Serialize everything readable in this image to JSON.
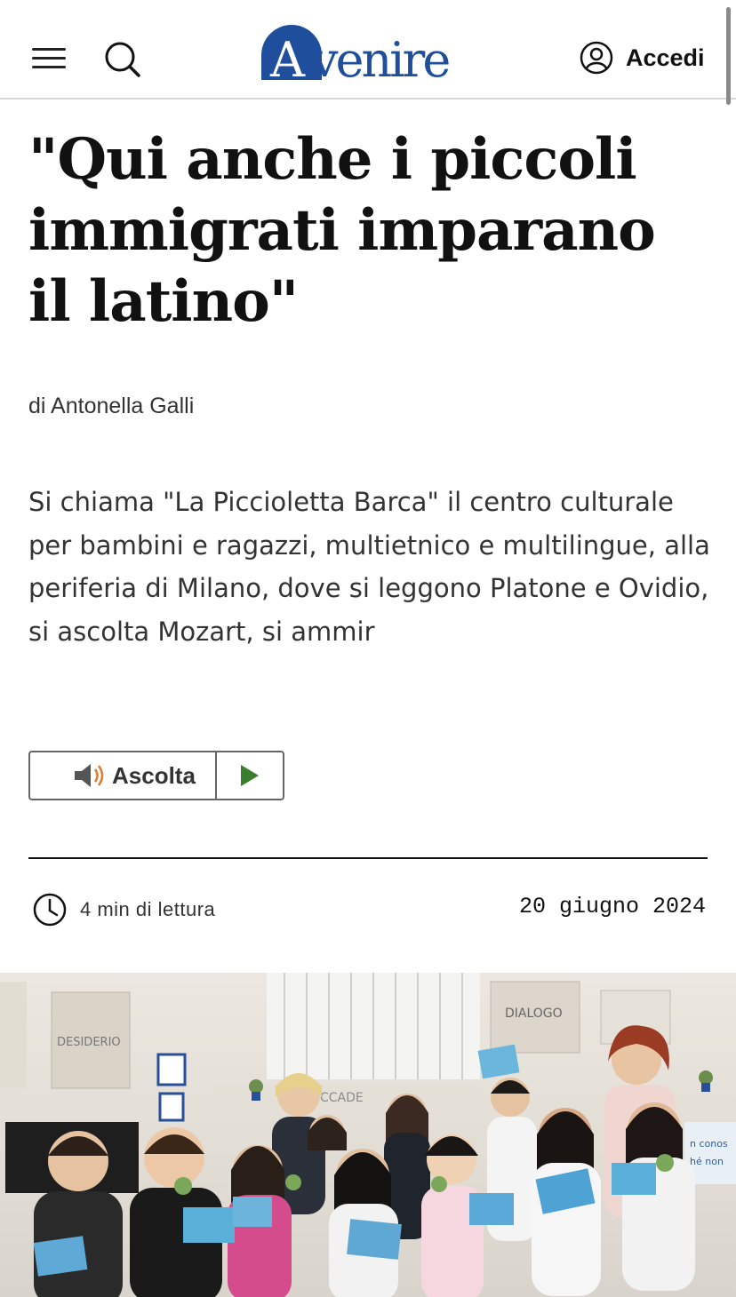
{
  "header": {
    "brand": "Avvenire",
    "login_label": "Accedi"
  },
  "article": {
    "title": "\"Qui anche i piccoli immigrati imparano il latino\"",
    "byline_prefix": "di",
    "author": "Antonella Galli",
    "lead": "Si chiama \"La Piccioletta Barca\" il centro culturale per bambini e ragazzi, multietnico e multilingue, alla periferia di Milano, dove si leggono Platone e Ovidio, si ascolta Mozart, si ammir",
    "listen_label": "Ascolta",
    "reading_time": "4 min di lettura",
    "date": "20 giugno 2024"
  },
  "photo": {
    "wall_sign": "DESIDERIO",
    "board_label": "DIALOGO",
    "banner_text": "CCADE",
    "poster_text": "n conos\nhé non"
  },
  "colors": {
    "brand_blue": "#1f4e9c",
    "play_green": "#3a7d2c",
    "speaker_orange": "#e07b2e"
  },
  "icons": [
    "menu-icon",
    "search-icon",
    "user-icon",
    "speaker-icon",
    "play-icon",
    "clock-icon"
  ]
}
